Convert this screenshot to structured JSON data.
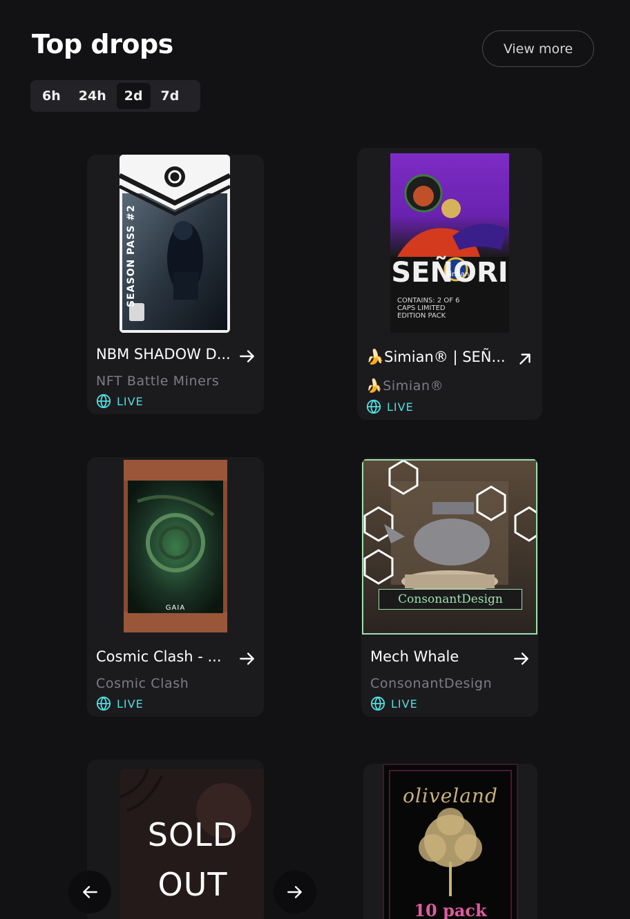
{
  "header": {
    "title": "Top drops",
    "view_more": "View more"
  },
  "filters": [
    {
      "label": "6h",
      "active": false
    },
    {
      "label": "24h",
      "active": false
    },
    {
      "label": "2d",
      "active": true
    },
    {
      "label": "7d",
      "active": false
    }
  ],
  "drops": [
    {
      "name": "NBM SHADOW D...",
      "collection": "NFT Battle Miners",
      "status": "LIVE",
      "art_text": "SEASON PASS #2"
    },
    {
      "name": "🍌Simian® | SEÑ...",
      "collection": "🍌Simian®",
      "status": "LIVE",
      "art_text": "SEÑORI",
      "art_sub": "CONTAINS: 2 OF 6 CAPS LIMITED EDITION PACK",
      "art_badge": "Simian"
    },
    {
      "name": "Cosmic Clash - ...",
      "collection": "Cosmic Clash",
      "status": "LIVE",
      "art_text": "GAIA"
    },
    {
      "name": "Mech Whale",
      "collection": "ConsonantDesign",
      "status": "LIVE",
      "art_text": "ConsonantDesign"
    },
    {
      "sold_line1": "SOLD",
      "sold_line2": "OUT"
    },
    {
      "art_title": "oliveland",
      "art_sub": "10 pack"
    }
  ],
  "colors": {
    "background": "#121214",
    "card": "#1b1b1e",
    "live": "#4fe0e0",
    "muted": "#7d7d84"
  }
}
